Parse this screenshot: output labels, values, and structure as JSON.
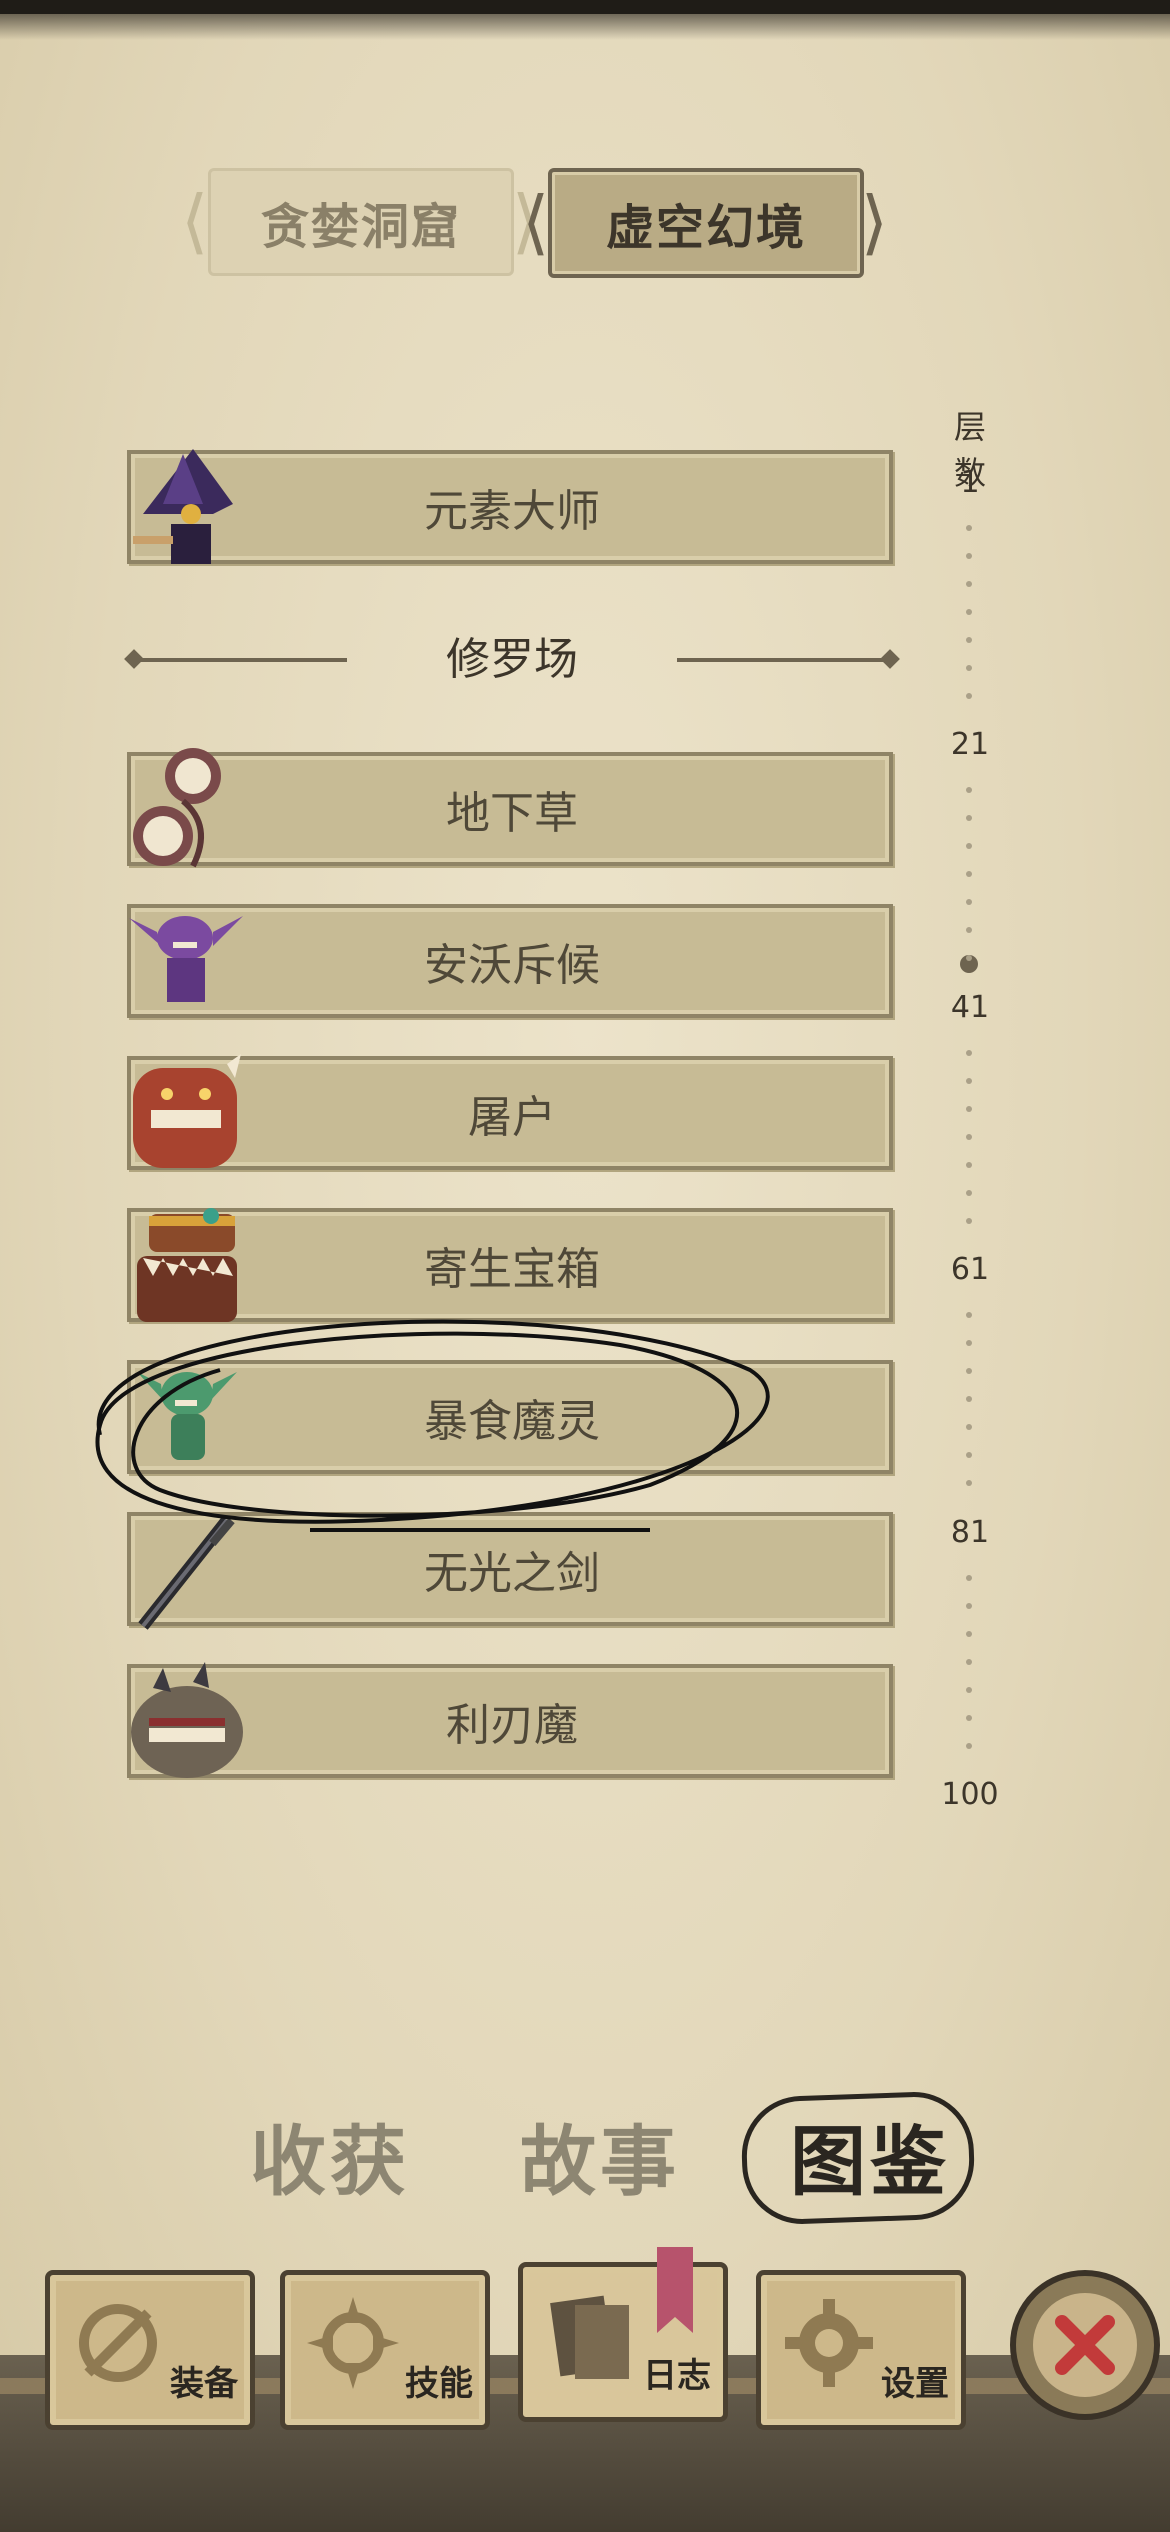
{
  "dungeon_tabs": [
    {
      "label": "贪婪洞窟",
      "active": false
    },
    {
      "label": "虚空幻境",
      "active": true
    }
  ],
  "floor_header": "层数",
  "floor_ticks": [
    "1",
    "21",
    "41",
    "61",
    "81",
    "100"
  ],
  "section_divider": "修罗场",
  "boss_top": {
    "name": "元素大师",
    "icon": "mage-icon"
  },
  "monsters": [
    {
      "name": "地下草",
      "icon": "toothed-plant-icon"
    },
    {
      "name": "安沃斥候",
      "icon": "purple-goblin-icon"
    },
    {
      "name": "屠户",
      "icon": "red-butcher-icon"
    },
    {
      "name": "寄生宝箱",
      "icon": "mimic-chest-icon"
    },
    {
      "name": "暴食魔灵",
      "icon": "green-imp-icon"
    },
    {
      "name": "无光之剑",
      "icon": "sword-icon"
    },
    {
      "name": "利刃魔",
      "icon": "spiked-beast-icon"
    }
  ],
  "sub_tabs": [
    {
      "label": "收获",
      "active": false
    },
    {
      "label": "故事",
      "active": false
    },
    {
      "label": "图鉴",
      "active": true
    }
  ],
  "nav": {
    "equip": "装备",
    "skill": "技能",
    "log": "日志",
    "settings": "设置"
  },
  "colors": {
    "plate": "#c7bb95",
    "ink": "#3c352a",
    "close_x": "#c23a3a",
    "bookmark": "#b7536c"
  }
}
